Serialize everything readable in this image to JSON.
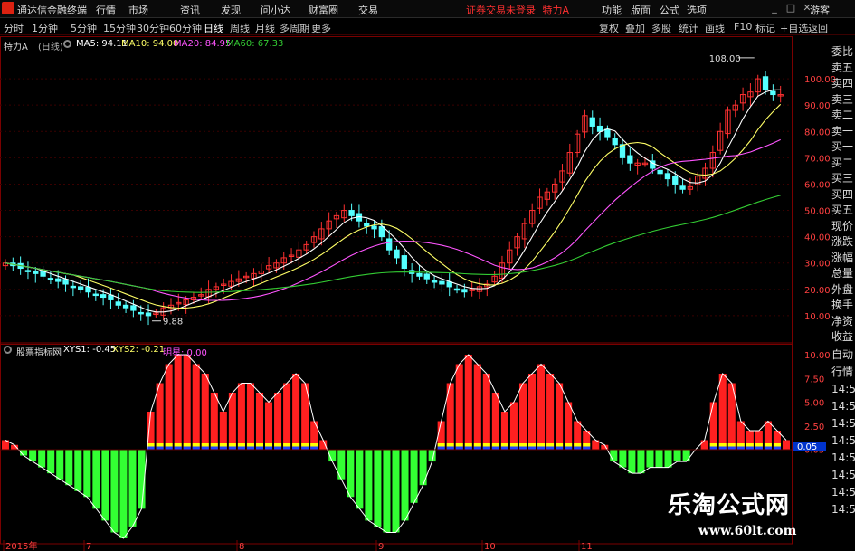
{
  "app": {
    "title": "通达信金融终端"
  },
  "menu": [
    "行情",
    "市场",
    "资讯",
    "发现",
    "问小达",
    "财富圈",
    "交易"
  ],
  "notice": "证券交易未登录",
  "stock_name": "特力A",
  "right_menu": [
    "功能",
    "版面",
    "公式",
    "选项",
    "游客"
  ],
  "periods": [
    "分时",
    "1分钟",
    "5分钟",
    "15分钟",
    "30分钟",
    "60分钟",
    "日线",
    "周线",
    "月线",
    "多周期",
    "更多"
  ],
  "active_period": "日线",
  "tools": [
    "复权",
    "叠加",
    "多股",
    "统计",
    "画线",
    "F10",
    "标记",
    "+自选",
    "返回"
  ],
  "main_legend": {
    "name": "特力A",
    "period_tag": "(日线)",
    "ma5": "MA5: 94.11",
    "ma10": "MA10: 94.00",
    "ma20": "MA20: 84.95",
    "ma60": "MA60: 67.33"
  },
  "sub_legend": {
    "name": "股票指标网",
    "xys1": "XYS1: -0.45",
    "xys2": "XYS2: -0.21",
    "extra": "明星: 0.00"
  },
  "price_axis": [
    "100.00",
    "90.00",
    "80.00",
    "70.00",
    "60.00",
    "50.00",
    "40.00",
    "30.00",
    "20.00",
    "10.00"
  ],
  "sub_axis": [
    "10.00",
    "7.50",
    "5.00",
    "2.50",
    "0.05"
  ],
  "sub_current_value": "0.05",
  "date_axis": [
    "2015年",
    "7",
    "8",
    "9",
    "10",
    "11"
  ],
  "annotations": {
    "high": "108.00",
    "low": "9.88"
  },
  "side_panel": [
    "委比",
    "卖五",
    "卖四",
    "卖三",
    "卖二",
    "卖一",
    "买一",
    "买二",
    "买三",
    "买四",
    "买五",
    "现价",
    "涨跌",
    "涨幅",
    "总量",
    "外盘",
    "换手",
    "净资",
    "收益"
  ],
  "side_panel2": [
    "自动",
    "行情",
    "14:50",
    "14:50",
    "14:50",
    "14:50",
    "14:50",
    "14:50",
    "14:50",
    "14:50"
  ],
  "watermark": {
    "line1": "乐淘公式网",
    "line2": "www.60lt.com"
  },
  "colors": {
    "up": "#ff3030",
    "down": "#54ffff",
    "ma5": "#ffffff",
    "ma10": "#ffff66",
    "ma20": "#ff55ff",
    "ma60": "#33cc33",
    "sub_pos": "#ff2020",
    "sub_neg": "#33ff33"
  },
  "chart_data": {
    "type": "candlestick",
    "ylim": [
      0,
      110
    ],
    "closes": [
      30,
      29,
      28,
      27,
      26,
      25,
      24,
      23,
      22,
      21,
      20,
      19,
      18,
      17,
      16,
      14,
      13,
      12,
      11,
      10,
      11,
      13,
      14,
      15,
      16,
      17,
      18,
      20,
      21,
      22,
      23,
      24,
      25,
      26,
      27,
      29,
      30,
      32,
      33,
      35,
      37,
      40,
      43,
      46,
      48,
      50,
      48,
      46,
      44,
      43,
      40,
      35,
      32,
      28,
      26,
      25,
      24,
      23,
      22,
      21,
      20,
      19,
      20,
      21,
      22,
      25,
      30,
      35,
      40,
      45,
      50,
      55,
      57,
      60,
      65,
      72,
      79,
      86,
      82,
      80,
      78,
      75,
      70,
      68,
      68,
      68,
      66,
      64,
      62,
      60,
      58,
      59,
      63,
      66,
      72,
      80,
      88,
      90,
      94,
      95,
      100,
      96,
      94,
      94
    ]
  },
  "sub_chart": {
    "values": [
      1,
      0.5,
      -1,
      -2,
      -3,
      -4,
      -5,
      -6,
      -7,
      -8,
      -10,
      -12,
      -14,
      -15,
      -13,
      -10,
      4,
      7,
      9,
      10,
      10,
      9,
      8,
      6,
      4,
      6,
      7,
      7,
      6,
      5,
      6,
      7,
      8,
      7,
      3,
      1,
      -2,
      -5,
      -8,
      -10,
      -12,
      -13,
      -14,
      -14,
      -12,
      -9,
      -6,
      -2,
      3,
      7,
      9,
      10,
      9,
      8,
      6,
      4,
      5,
      7,
      8,
      9,
      8,
      7,
      5,
      3,
      2,
      1,
      0.5,
      -2,
      -3,
      -4,
      -4,
      -3,
      -3,
      -3,
      -2,
      -2,
      0,
      1,
      5,
      8,
      7,
      3,
      2,
      2,
      3,
      2,
      1
    ]
  }
}
